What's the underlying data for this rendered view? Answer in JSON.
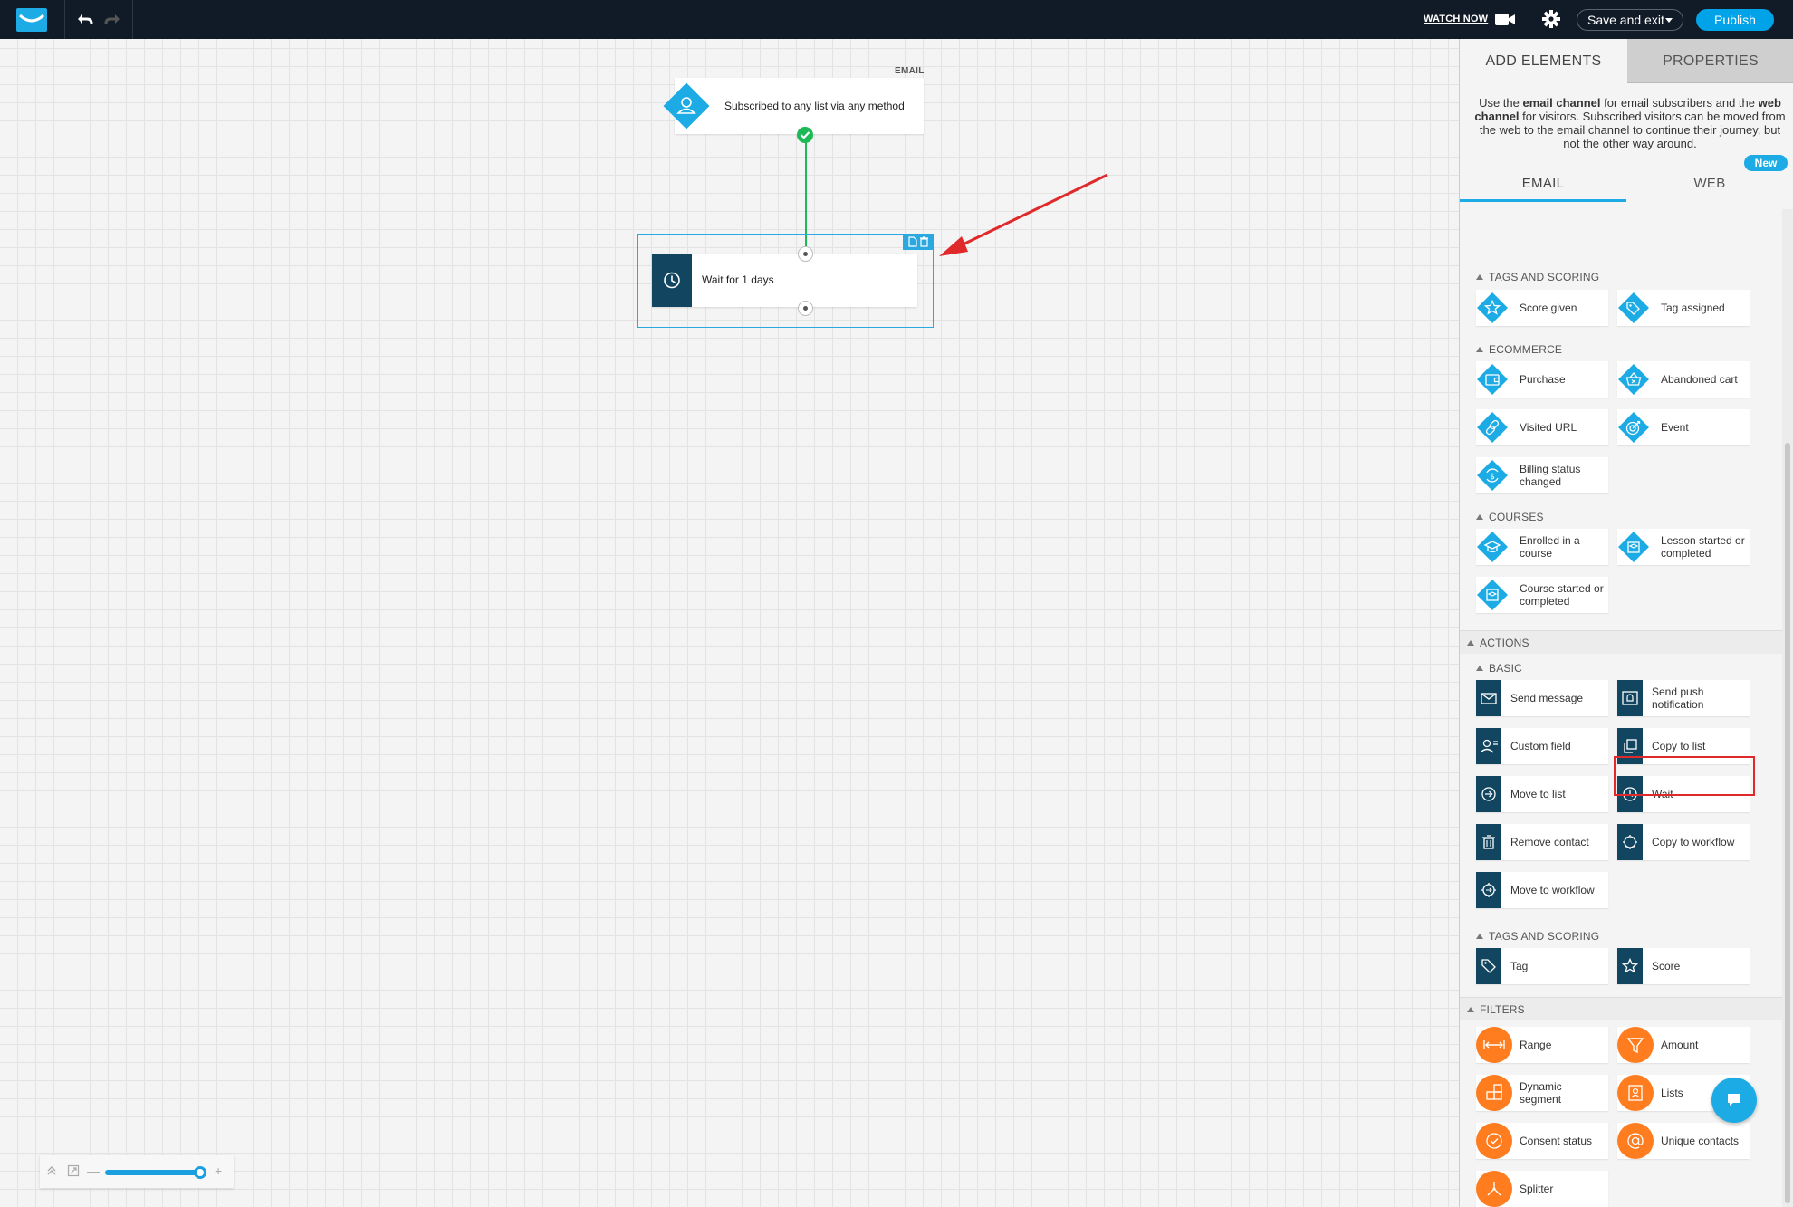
{
  "topbar": {
    "logo_icon": "getresponse-envelope-icon",
    "undo_icon": "undo-icon",
    "redo_icon": "redo-icon",
    "watch_now": "WATCH NOW",
    "video_icon": "video-camera-icon",
    "settings_icon": "gear-icon",
    "save_exit": "Save and exit",
    "publish": "Publish"
  },
  "canvas": {
    "channel_label": "EMAIL",
    "trigger_node": {
      "label": "Subscribed to any list via any method",
      "icon": "user-icon",
      "color": "#1cabe5"
    },
    "wait_node": {
      "label": "Wait for 1 days",
      "icon": "clock-icon",
      "color": "#124660"
    },
    "connector_color": "#1cb956"
  },
  "zoom": {
    "level": 1.0
  },
  "panel": {
    "tabs": {
      "add_elements": "ADD ELEMENTS",
      "properties": "PROPERTIES"
    },
    "intro": {
      "p1": "Use the ",
      "b1": "email channel",
      "p2": " for email subscribers and the ",
      "b2": "web channel",
      "p3": " for visitors. Subscribed visitors can be moved from the web to the email channel to continue their journey, but not the other way around."
    },
    "new_badge": "New",
    "channel_tabs": {
      "email": "EMAIL",
      "web": "WEB"
    },
    "conditions": {
      "tags_scoring": {
        "title": "TAGS AND SCORING",
        "items": [
          "Score given",
          "Tag assigned"
        ]
      },
      "ecommerce": {
        "title": "ECOMMERCE",
        "items": [
          "Purchase",
          "Abandoned cart",
          "Visited URL",
          "Event",
          "Billing status changed"
        ]
      },
      "courses": {
        "title": "COURSES",
        "items": [
          "Enrolled in a course",
          "Lesson started or completed",
          "Course started or completed"
        ]
      }
    },
    "actions": {
      "title": "ACTIONS",
      "basic": {
        "title": "BASIC",
        "items": [
          "Send message",
          "Send push notification",
          "Custom field",
          "Copy to list",
          "Move to list",
          "Wait",
          "Remove contact",
          "Copy to workflow",
          "Move to workflow"
        ]
      },
      "tags_scoring": {
        "title": "TAGS AND SCORING",
        "items": [
          "Tag",
          "Score"
        ]
      }
    },
    "filters": {
      "title": "FILTERS",
      "items": [
        "Range",
        "Amount",
        "Dynamic segment",
        "Lists",
        "Consent status",
        "Unique contacts",
        "Splitter"
      ]
    },
    "colors": {
      "condition": "#1cabe5",
      "action": "#124660",
      "filter": "#ff7d1f"
    }
  }
}
